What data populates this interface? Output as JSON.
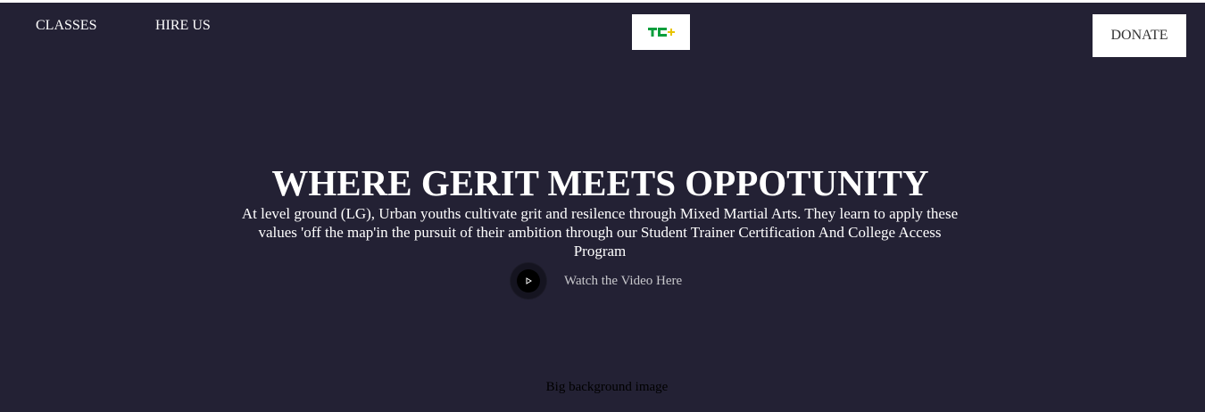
{
  "nav": {
    "classes_label": "CLASSES",
    "hire_label": "HIRE US",
    "donate_label": "DONATE"
  },
  "logo": {
    "text": "TC+",
    "color": "#0a9e3c",
    "plus_color": "#e8c400"
  },
  "hero": {
    "background_color": "#232134",
    "headline": "WHERE GERIT MEETS OPPOTUNITY",
    "subtext": "At level ground (LG), Urban youths cultivate grit and resilence through Mixed Martial Arts. They learn to apply these values 'off the map'in the pursuit of their ambition through our Student Trainer Certification And College Access Program",
    "video_label": "Watch the Video Here",
    "background_caption": "Big background image"
  }
}
